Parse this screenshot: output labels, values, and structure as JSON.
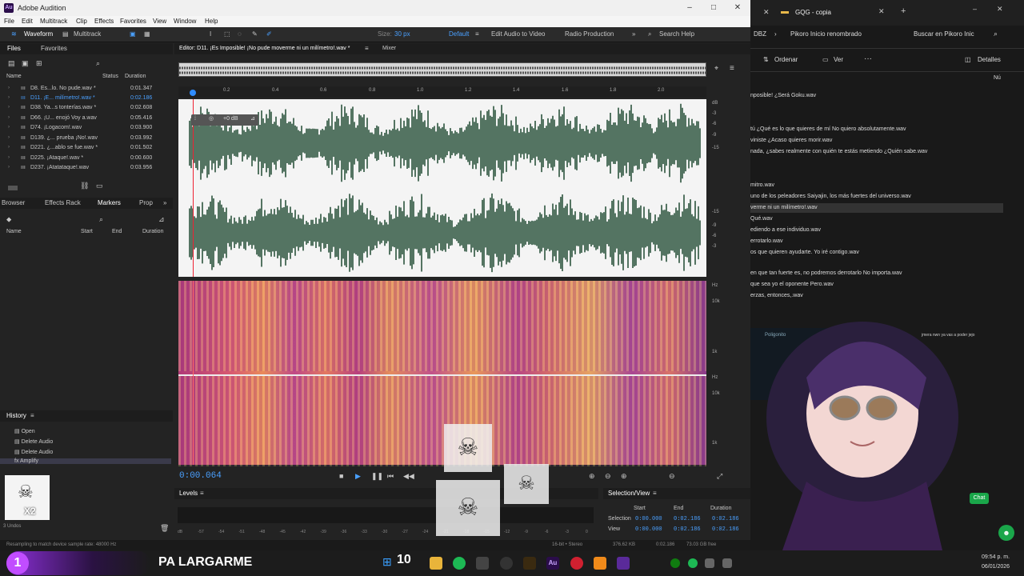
{
  "app_title": "Adobe Audition",
  "app_logo": "Au",
  "menu": [
    "File",
    "Edit",
    "Multitrack",
    "Clip",
    "Effects",
    "Favorites",
    "View",
    "Window",
    "Help"
  ],
  "toolbar": {
    "waveform": "Waveform",
    "multitrack": "Multitrack",
    "size_label": "Size:",
    "size_value": "30 px",
    "workspace": "Default",
    "edit_video": "Edit Audio to Video",
    "radio": "Radio Production",
    "search": "Search Help"
  },
  "files_panel": {
    "tabs": [
      "Files",
      "Favorites"
    ],
    "cols": [
      "Name",
      "Status",
      "Duration"
    ],
    "rows": [
      {
        "name": "D8. Es...lo. No pude.wav *",
        "dur": "0:01.347"
      },
      {
        "name": "D11. ¡E... milímetro!.wav *",
        "dur": "0:02.186"
      },
      {
        "name": "D38. Ya...s tonterías.wav *",
        "dur": "0:02.608"
      },
      {
        "name": "D66. ¡U... enojó Voy a.wav",
        "dur": "0:05.416"
      },
      {
        "name": "D74. ¡Logacom!.wav",
        "dur": "0:03.900"
      },
      {
        "name": "D139. ¿... prueba ¡No!.wav",
        "dur": "0:03.992"
      },
      {
        "name": "D221. ¿...ablo se fue.wav *",
        "dur": "0:01.502"
      },
      {
        "name": "D225. ¡Ataque!.wav *",
        "dur": "0:00.600"
      },
      {
        "name": "D237. ¡Atatataque!.wav",
        "dur": "0:03.956"
      }
    ]
  },
  "markers_panel": {
    "tabs": [
      "Browser",
      "Effects Rack",
      "Markers",
      "Prop"
    ],
    "cols": [
      "Name",
      "Start",
      "End",
      "Duration"
    ]
  },
  "history_panel": {
    "title": "History",
    "items": [
      "Open",
      "Delete Audio",
      "Delete Audio",
      "Amplify"
    ],
    "undos": "3 Undos"
  },
  "editor": {
    "tab": "Editor: D11. ¡Es Imposible! ¡No pude moverme ni un milímetro!.wav *",
    "mixer": "Mixer",
    "timecode": "0:00.064",
    "hud": "+0 dB",
    "ruler": [
      "0.2",
      "0.4",
      "0.6",
      "0.8",
      "1.0",
      "1.2",
      "1.4",
      "1.6",
      "1.8",
      "2.0"
    ],
    "db_scale": [
      "dB",
      "-3",
      "-6",
      "-9",
      "-15",
      "-15",
      "-9",
      "-6",
      "-3"
    ],
    "hz_scale": [
      "Hz",
      "10k",
      "1k",
      "Hz",
      "10k",
      "1k"
    ]
  },
  "levels": {
    "title": "Levels",
    "scale": [
      "dB",
      "-57",
      "-54",
      "-51",
      "-48",
      "-45",
      "-42",
      "-39",
      "-36",
      "-33",
      "-30",
      "-27",
      "-24",
      "-21",
      "-18",
      "-15",
      "-12",
      "-9",
      "-6",
      "-3",
      "0"
    ]
  },
  "selection_view": {
    "title": "Selection/View",
    "cols": [
      "Start",
      "End",
      "Duration"
    ],
    "rows": [
      {
        "label": "Selection",
        "start": "0:00.000",
        "end": "0:02.186",
        "dur": "0:02.186"
      },
      {
        "label": "View",
        "start": "0:00.000",
        "end": "0:02.186",
        "dur": "0:02.186"
      }
    ]
  },
  "status": {
    "left": "Resampling to match device sample rate: 48000 Hz",
    "format": "16-bit • Stereo",
    "size": "376.62 KB",
    "dur": "0:02.186",
    "free": "73.03 GB free"
  },
  "explorer": {
    "tab": "GQG - copia",
    "nav_left": "DBZ",
    "nav_mid": "Pikoro Inicio renombrado",
    "search": "Buscar en Pikoro Inic",
    "sort": "Ordenar",
    "view": "Ver",
    "details": "Detalles",
    "col_num": "Nú",
    "files": [
      "nposible! ¿Será Goku.wav",
      "tú ¿Qué es lo que quieres de mí No quiero absolutamente.wav",
      "viniste ¿Acaso quieres morir.wav",
      "nada, ¿sabes realmente con quién te estás metiendo ¿Quién sabe.wav",
      "mitro.wav",
      "uno de los peleadores Saiyajin, los más fuertes del universo.wav",
      "verme ni un milímetro!.wav",
      "Qué.wav",
      "ediendo a ese individuo.wav",
      "errotarlo.wav",
      "os que quieren ayudarte. Yo iré contigo.wav",
      "en que tan fuerte es, no podremos derrotarlo No importa.wav",
      "que sea yo el oponente Pero.wav",
      "erzas, entonces,.wav"
    ]
  },
  "chat": {
    "label": "Chat",
    "snippet1": "Poligonito",
    "snippet2": "jmera nwn ya vas a poder jejo"
  },
  "overlay": {
    "caption": "PA LARGARME",
    "counter": "10",
    "badge": "1",
    "avatar_count": "X2"
  },
  "clock": {
    "time": "09:54 p. m.",
    "date": "06/01/2026"
  },
  "colors": {
    "accent": "#2f8cff",
    "wave": "#1f4a32",
    "au_purple": "#9b4cff"
  }
}
